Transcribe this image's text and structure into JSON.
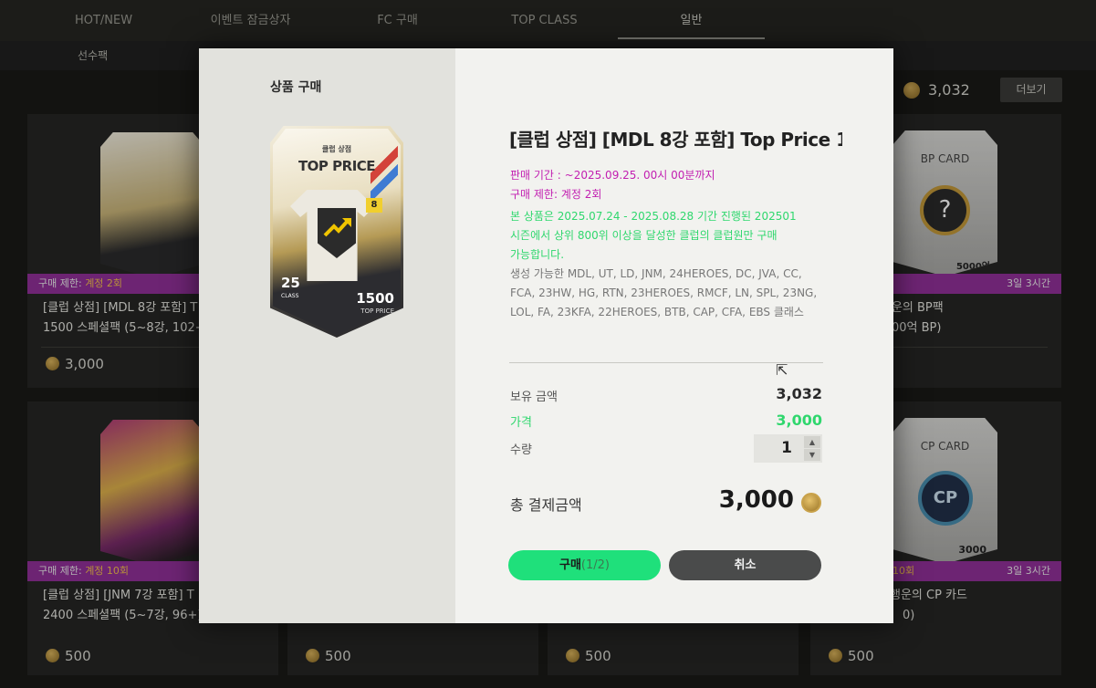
{
  "tabs": [
    "HOT/NEW",
    "이벤트 잠금상자",
    "FC 구매",
    "TOP CLASS",
    "일반"
  ],
  "active_tab": "일반",
  "subtab": "선수팩",
  "header": {
    "balance": "3,032",
    "more_label": "더보기"
  },
  "background_cards": [
    {
      "limit_prefix": "구매 제한: ",
      "limit_value": "계정 2회",
      "right_text": "",
      "title_line1": "[클럽 상점] [MDL 8강 포함] T",
      "title_line2": "1500 스페셜팩 (5~8강, 102+",
      "price": "3,000"
    },
    {
      "limit_prefix": "",
      "limit_value": "회",
      "right_text": "3일 3시간",
      "title_line1": "행운의 BP팩",
      "title_line2": "00억 BP)",
      "price": "",
      "card_text": "BP CARD",
      "card_value": "5000억"
    },
    {
      "limit_prefix": "구매 제한: ",
      "limit_value": "계정 10회",
      "right_text": "",
      "title_line1": "[클럽 상점] [JNM 7강 포함] T",
      "title_line2": "2400 스페셜팩 (5~7강, 96+)",
      "price": "500"
    },
    {
      "limit_prefix": "",
      "limit_value": "",
      "right_text": "",
      "title_line1": "",
      "title_line2": "",
      "price": "500"
    },
    {
      "limit_prefix": "",
      "limit_value": "",
      "right_text": "",
      "title_line1": "",
      "title_line2": "",
      "price": "500"
    },
    {
      "limit_prefix": "",
      "limit_value": "10회",
      "right_text": "3일 3시간",
      "title_line1": "행운의 CP 카드",
      "title_line2": "0)",
      "price": "500",
      "card_text": "CP CARD",
      "card_value": "3000"
    }
  ],
  "modal": {
    "title": "상품 구매",
    "pack": {
      "label_small": "클럽 상점",
      "label": "TOP PRICE",
      "badge": "8",
      "num": "25",
      "class_label": "CLASS",
      "price": "1500",
      "price_label": "TOP PRICE"
    },
    "product_title": "[클럽 상점] [MDL 8강 포함] Top Price 1",
    "sale_period": "판매 기간 : ~2025.09.25. 00시 00분까지",
    "purchase_limit": "구매 제한: 계정 2회",
    "notice_line1": "본 상품은 2025.07.24 - 2025.08.28 기간 진행된 202501",
    "notice_line2": "시즌에서 상위 800위 이상을 달성한 클럽의 클럽원만 구매",
    "notice_line3": "가능합니다.",
    "avail_line1": "생성 가능한 MDL, UT, LD, JNM, 24HEROES, DC, JVA, CC,",
    "avail_line2": "FCA, 23HW, HG, RTN, 23HEROES, RMCF, LN, SPL, 23NG,",
    "avail_line3": "LOL, FA, 23KFA, 22HEROES, BTB, CAP, CFA, EBS 클래스",
    "balance_label": "보유 금액",
    "balance_value": "3,032",
    "price_label": "가격",
    "price_value": "3,000",
    "qty_label": "수량",
    "qty_value": "1",
    "total_label": "총 결제금액",
    "total_value": "3,000",
    "buy_label": "구매",
    "buy_count": "(1/2)",
    "cancel_label": "취소"
  }
}
